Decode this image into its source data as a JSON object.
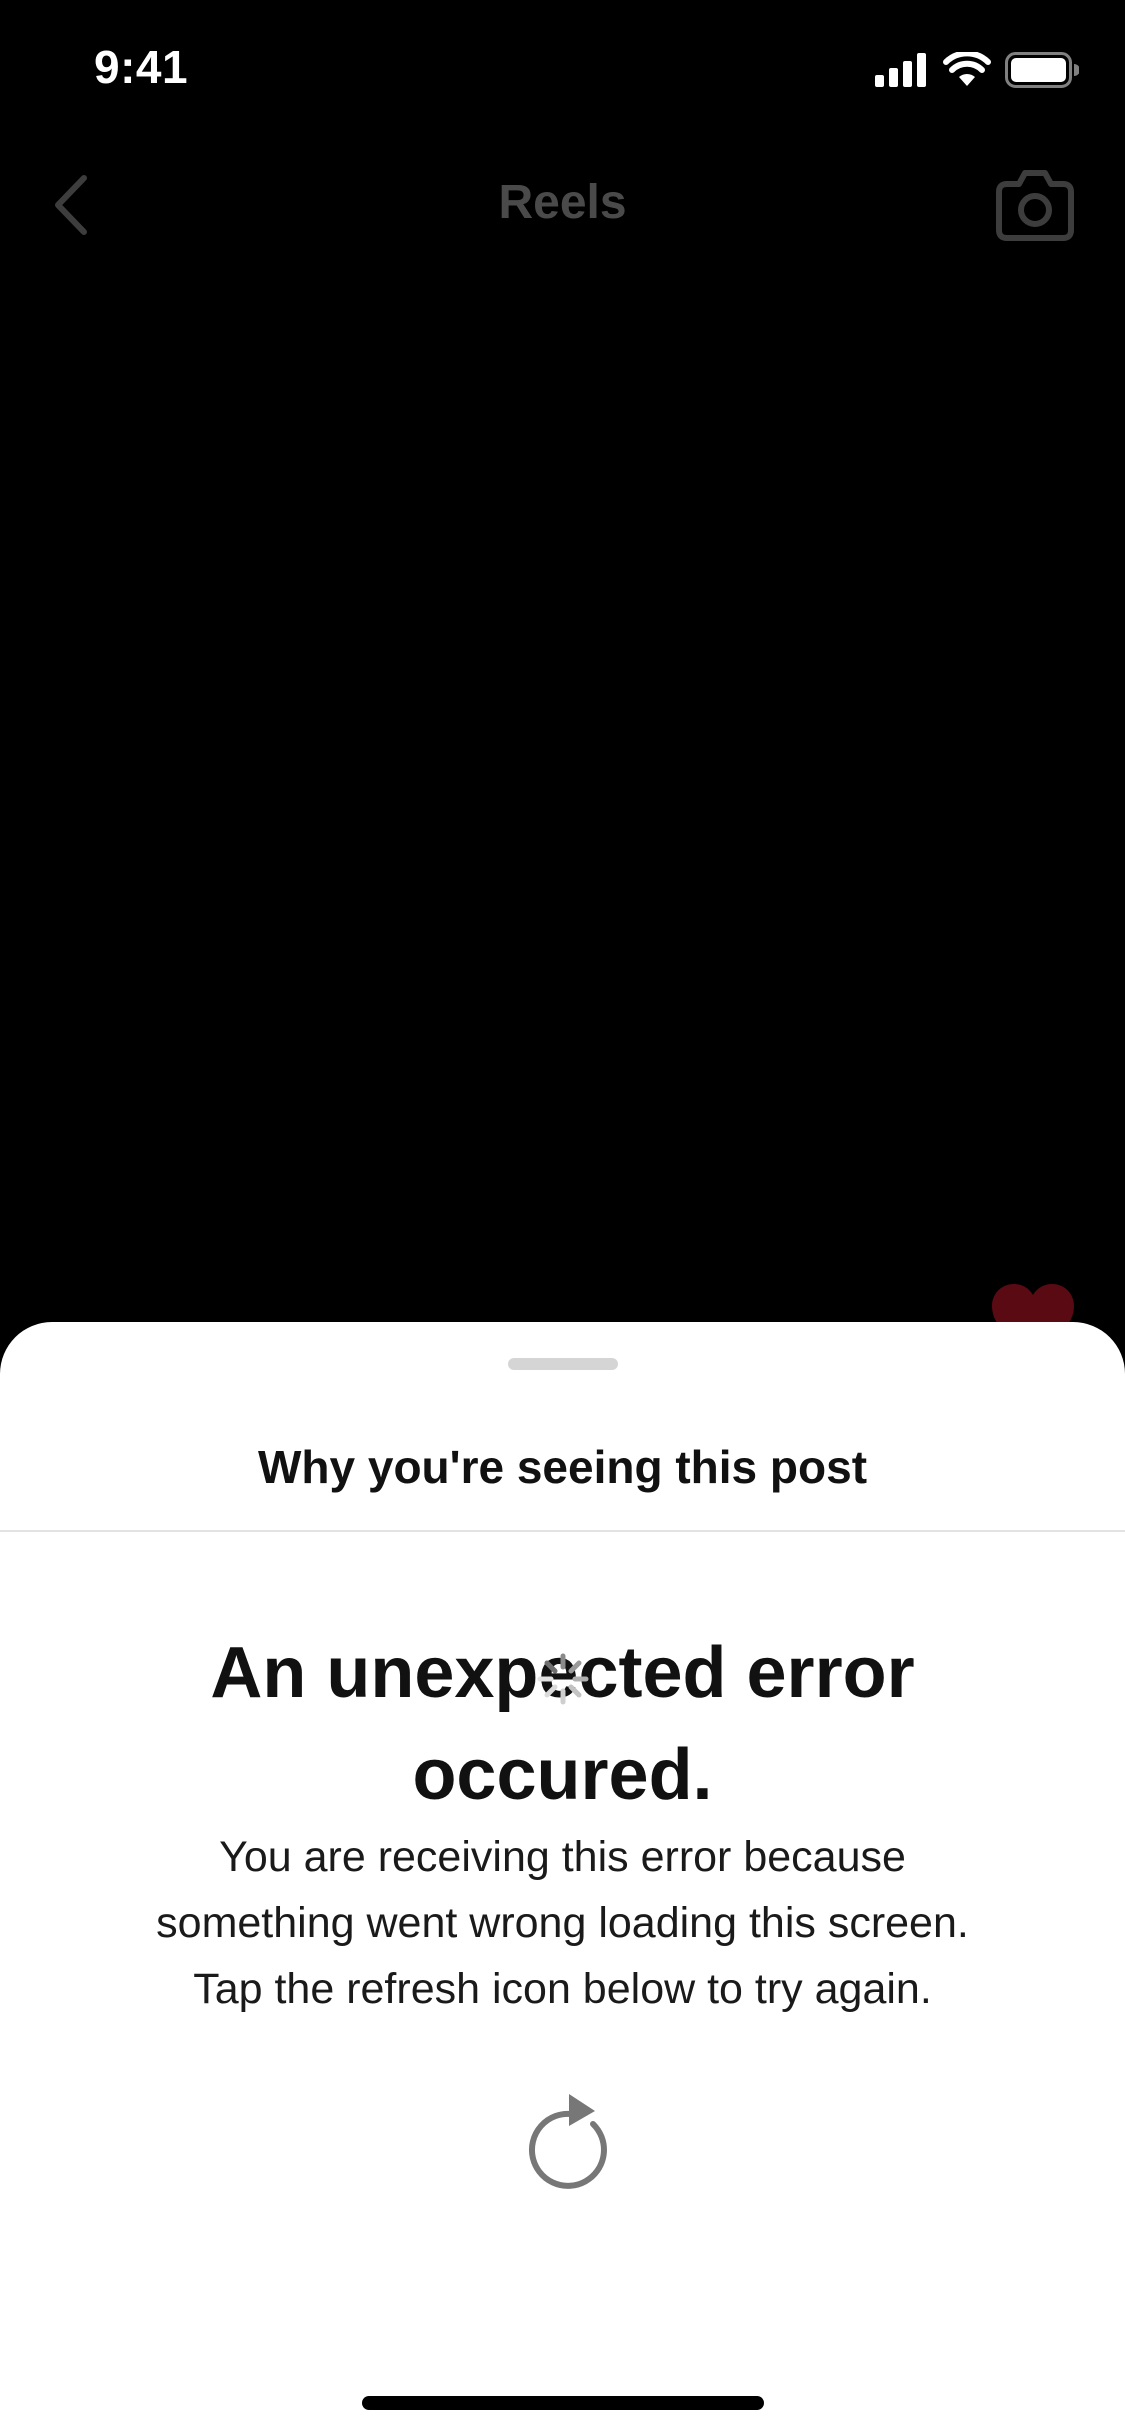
{
  "status_bar": {
    "time": "9:41",
    "icons": [
      "cellular-signal-icon",
      "wifi-icon",
      "battery-icon"
    ]
  },
  "nav": {
    "back_icon": "chevron-left-icon",
    "title": "Reels",
    "camera_icon": "camera-icon"
  },
  "sheet": {
    "title": "Why you're seeing this post",
    "error_heading": "An unexpected error occured.",
    "error_body_lines": [
      "You are receiving this error because",
      "something went wrong loading this screen.",
      "Tap the refresh icon below to try again."
    ],
    "refresh_icon": "refresh-icon",
    "loading_icon": "loading-spinner-icon"
  },
  "colors": {
    "background": "#000000",
    "sheet": "#ffffff",
    "nav_title": "#4a4a4a",
    "heart": "#5a0a12",
    "refresh_icon": "#777777"
  }
}
